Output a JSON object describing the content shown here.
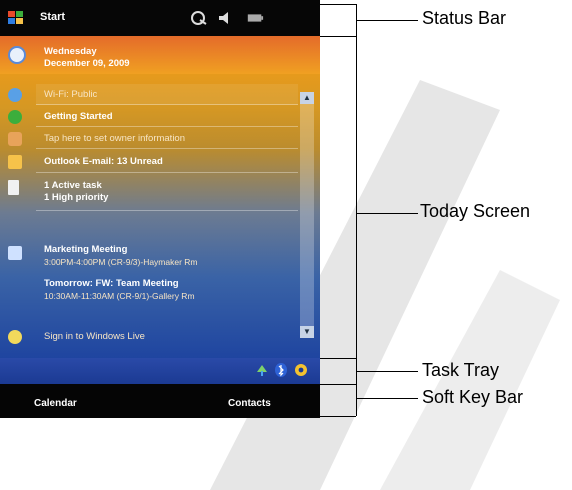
{
  "status_bar": {
    "start_label": "Start"
  },
  "today_items": [
    {
      "icon": "clock-icon",
      "color": "#e9f0fb",
      "lines": [
        "Wednesday",
        "December 09, 2009"
      ],
      "style": "bold"
    },
    {
      "icon": "wifi-icon",
      "color": "#59a0e6",
      "lines": [
        "Wi-Fi: Public"
      ],
      "style": "dim"
    },
    {
      "icon": "getting-started-icon",
      "color": "#3cae3c",
      "lines": [
        "Getting Started"
      ],
      "style": "bold"
    },
    {
      "icon": "owner-icon",
      "color": "#e8a35a",
      "lines": [
        "Tap here to set owner information"
      ],
      "style": "dim"
    },
    {
      "icon": "email-icon",
      "color": "#f6c24a",
      "lines": [
        "Outlook E-mail: 13 Unread"
      ],
      "style": "bold"
    },
    {
      "icon": "task-icon",
      "color": "#f1f1f1",
      "lines": [
        "1 Active task",
        "1 High priority"
      ],
      "style": "bold"
    },
    {
      "icon": "calendar-icon",
      "color": "#cfe1ff",
      "lines": [
        "Marketing Meeting",
        "3:00PM-4:00PM (CR-9/3)-Haymaker Rm",
        "Tomorrow: FW: Team Meeting",
        "10:30AM-11:30AM (CR-9/1)-Gallery Rm"
      ],
      "style": "bold"
    },
    {
      "icon": "windows-live-icon",
      "color": "#f2d95c",
      "lines": [
        "Sign in to Windows Live"
      ],
      "style": "dim"
    }
  ],
  "soft_keys": {
    "left": "Calendar",
    "right": "Contacts"
  },
  "callouts": {
    "status_bar": "Status Bar",
    "today_screen": "Today Screen",
    "task_tray": "Task Tray",
    "soft_key_bar": "Soft Key Bar"
  }
}
